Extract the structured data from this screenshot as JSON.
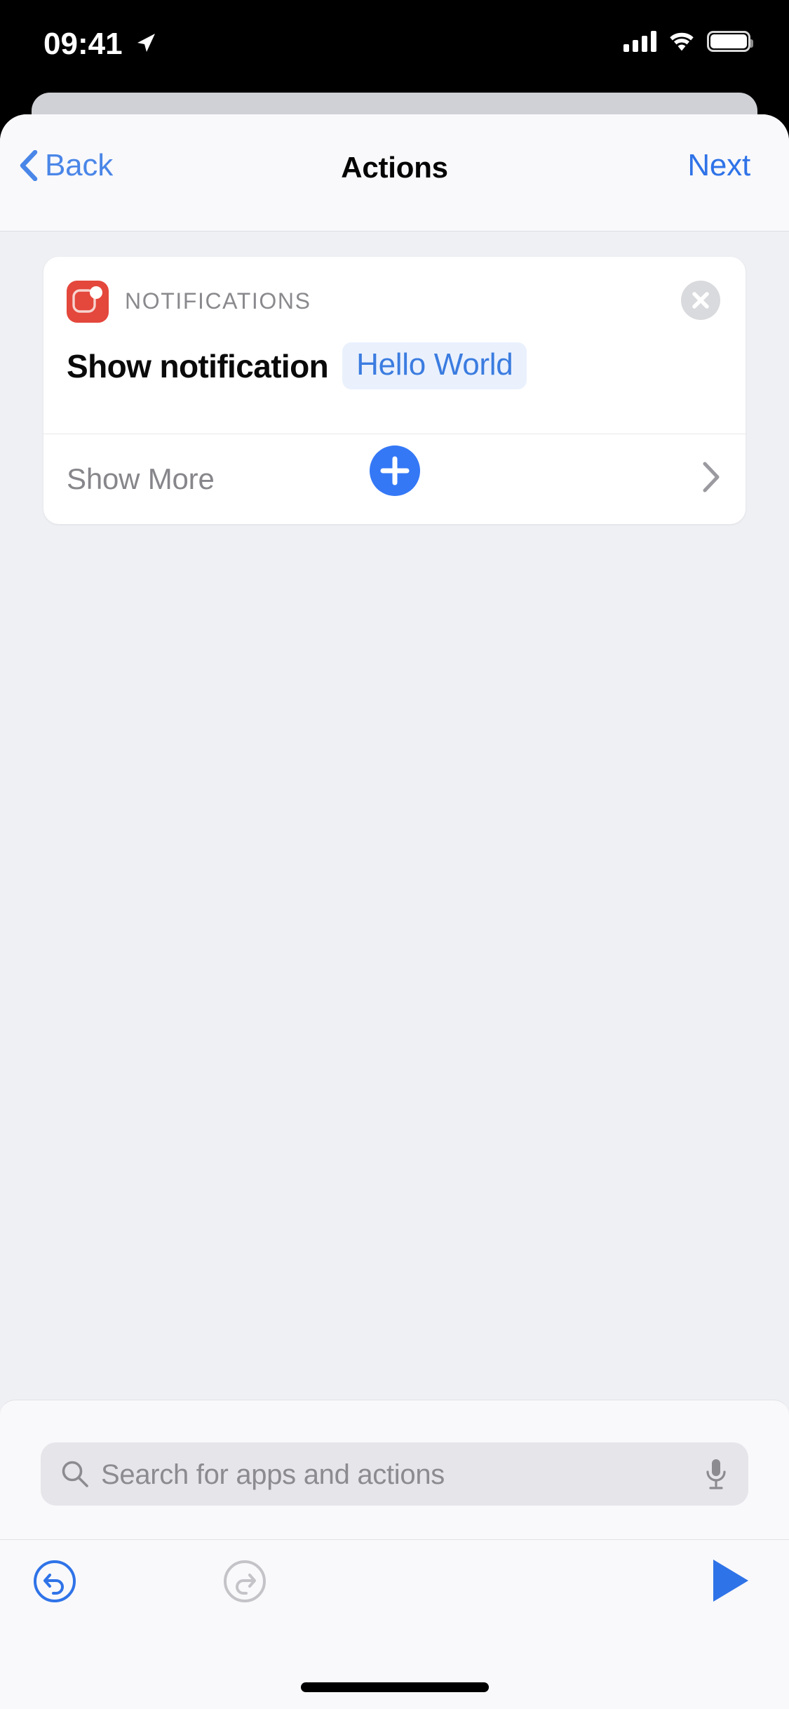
{
  "status_bar": {
    "time": "09:41",
    "location_icon": "location-arrow-icon",
    "cellular_icon": "cellular-signal-icon",
    "wifi_icon": "wifi-icon",
    "battery_icon": "battery-full-icon"
  },
  "nav": {
    "back_label": "Back",
    "back_icon": "chevron-left-icon",
    "title": "Actions",
    "next_label": "Next"
  },
  "action_card": {
    "app_icon": "notifications-app-icon",
    "app_label": "NOTIFICATIONS",
    "remove_icon": "close-circle-icon",
    "title": "Show notification",
    "token_value": "Hello World",
    "show_more_label": "Show More",
    "show_more_icon": "chevron-right-icon"
  },
  "add_action": {
    "icon": "plus-icon",
    "label": "+"
  },
  "search": {
    "placeholder": "Search for apps and actions",
    "value": "",
    "icon": "search-icon",
    "mic_icon": "microphone-icon"
  },
  "toolbar": {
    "undo_icon": "undo-circle-icon",
    "redo_icon": "redo-circle-icon",
    "run_icon": "play-icon"
  },
  "colors": {
    "accent_blue": "#3478f6",
    "link_blue": "#4a86e8",
    "next_blue": "#2f73e8",
    "notifications_red": "#e4473c",
    "token_text": "#3b7ce0",
    "token_background": "#eaf1fd",
    "sheet_background": "#eff0f4",
    "card_white": "#ffffff",
    "disabled_gray": "#c4c4c8"
  }
}
